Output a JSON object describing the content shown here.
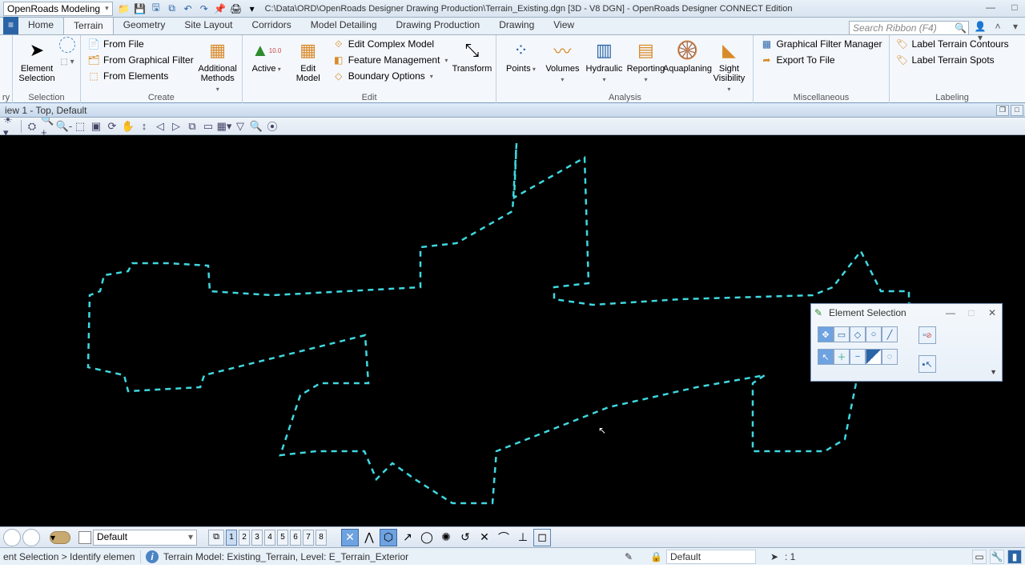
{
  "title": {
    "workflow": "OpenRoads Modeling",
    "doc_path": "C:\\Data\\ORD\\OpenRoads Designer Drawing Production\\Terrain_Existing.dgn [3D - V8 DGN] - OpenRoads Designer CONNECT Edition"
  },
  "tabs": {
    "home": "Home",
    "terrain": "Terrain",
    "geometry": "Geometry",
    "site": "Site Layout",
    "corridors": "Corridors",
    "model_detailing": "Model Detailing",
    "drawing_prod": "Drawing Production",
    "drawing": "Drawing",
    "view": "View"
  },
  "search_ribbon_placeholder": "Search Ribbon (F4)",
  "ribbon": {
    "selection": {
      "label": "Selection",
      "element_selection": "Element\nSelection"
    },
    "create": {
      "label": "Create",
      "from_file": "From File",
      "from_graphical_filter": "From Graphical Filter",
      "from_elements": "From Elements",
      "additional_methods": "Additional\nMethods"
    },
    "edit": {
      "label": "Edit",
      "active": "Active",
      "edit_model": "Edit\nModel",
      "edit_complex_model": "Edit Complex Model",
      "feature_management": "Feature Management",
      "boundary_options": "Boundary Options",
      "transform": "Transform"
    },
    "analysis": {
      "label": "Analysis",
      "points": "Points",
      "volumes": "Volumes",
      "hydraulic": "Hydraulic",
      "reporting": "Reporting",
      "aquaplaning": "Aquaplaning",
      "sight": "Sight\nVisibility"
    },
    "misc": {
      "label": "Miscellaneous",
      "gfm": "Graphical Filter Manager",
      "export": "Export To File"
    },
    "labeling": {
      "label": "Labeling",
      "contours": "Label Terrain Contours",
      "spots": "Label Terrain Spots"
    }
  },
  "view_header": "iew 1 - Top, Default",
  "es_win": {
    "title": "Element Selection"
  },
  "bottom": {
    "level": "Default",
    "views": [
      "1",
      "2",
      "3",
      "4",
      "5",
      "6",
      "7",
      "8"
    ]
  },
  "status": {
    "prompt": "ent Selection > Identify element to a",
    "hover": "Terrain Model: Existing_Terrain, Level: E_Terrain_Exterior",
    "active_level": "Default",
    "sel_count": ": 1"
  }
}
